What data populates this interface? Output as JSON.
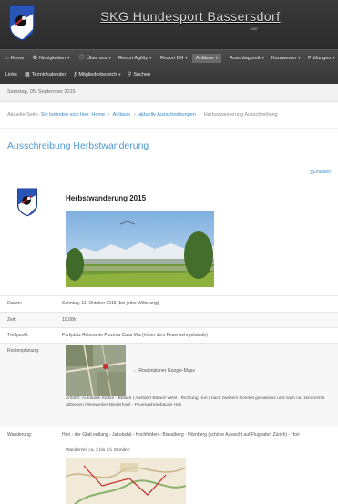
{
  "header": {
    "title": "SKG Hundesport Bassersdorf",
    "year": "1997"
  },
  "nav": {
    "items": [
      {
        "label": "Home",
        "icon": "home-icon"
      },
      {
        "label": "Neuigkeiten",
        "icon": "star-icon",
        "caret": true
      },
      {
        "label": "Über uns",
        "icon": "info-icon",
        "caret": true
      },
      {
        "label": "Resort Agility",
        "caret": true
      },
      {
        "label": "Resort BH",
        "caret": true
      },
      {
        "label": "Anlässe",
        "caret": true,
        "active": true
      },
      {
        "label": "Anschlagbrett",
        "caret": true
      },
      {
        "label": "Kurswesen",
        "caret": true
      },
      {
        "label": "Prüfungen",
        "caret": true
      },
      {
        "label": "Links"
      },
      {
        "label": "Terminkalender",
        "icon": "calendar-icon"
      },
      {
        "label": "Mitgliederbereich",
        "icon": "key-icon",
        "caret": true
      },
      {
        "label": "Suchen",
        "icon": "search-icon"
      }
    ]
  },
  "date_bar": "Samstag, 05. September 2015",
  "breadcrumb": {
    "prefix": "Aktuelle Seite:",
    "here": "Sie befinden sich hier:",
    "items": [
      "Home",
      "Anlässe",
      "aktuelle Ausschreibungen"
    ],
    "current": "Herbstwanderung Ausschreibung"
  },
  "page_title": "Ausschreibung Herbstwanderung",
  "print_label": "Drucken",
  "event_title": "Herbstwanderung 2015",
  "table": {
    "rows": [
      {
        "label": "Datum:",
        "value": "Sonntag, 11. Oktober 2015 (bei jeder Witterung)"
      },
      {
        "label": "Zeit:",
        "value": "10.00h"
      },
      {
        "label": "Treffpunkt:",
        "value": "Parkplatz Ristorante Pizzeria Casa Mia (hinter dem Feuerwehrgebäude)"
      },
      {
        "label": "Routenplanung:",
        "value": ""
      },
      {
        "label": "Wanderung:",
        "value": "Hori - der Glatt entlang - Jakobstal - Hochfelden - Bissalberg - Hörnberg (schöne Aussicht auf Flughafen Zürich) - Hori"
      }
    ]
  },
  "map_caption": "← Routenplaner Google-Maps",
  "route_description": "Anfahrt: Autobahn Kloten - Bülach ( Ausfahrt Bülach West ) Richtung Hori ( nach zweitem Rondell geradeaus und nach ca. 1km rechts abbiegen (Wegweiser Niederhori) - Feuerwehrgebäude Hori",
  "hike_time": "Wanderzeit ca. 2 bis 2½ Stunden",
  "colors": {
    "link": "#3a89c9",
    "title": "#4f9ad6",
    "header": "#2b2b2b"
  }
}
